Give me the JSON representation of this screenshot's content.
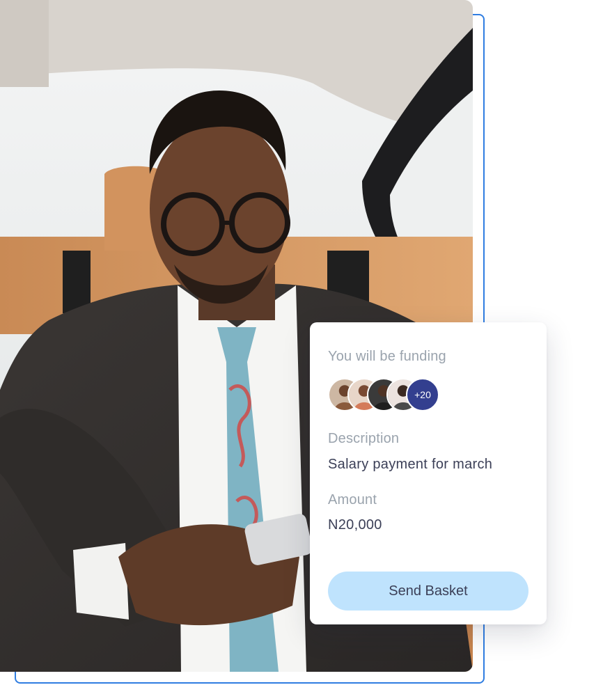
{
  "card": {
    "funding_label": "You will be funding",
    "avatars": [
      {
        "name": "avatar-1",
        "color": "#8a5a3c"
      },
      {
        "name": "avatar-2",
        "color": "#b06a4a"
      },
      {
        "name": "avatar-3",
        "color": "#2c2c2c"
      },
      {
        "name": "avatar-4",
        "color": "#d9c7c0"
      }
    ],
    "more_count": "+20",
    "description_label": "Description",
    "description_value": "Salary payment for march",
    "amount_label": "Amount",
    "amount_value": "N20,000",
    "send_button_label": "Send Basket"
  },
  "colors": {
    "accent_outline": "#2f7de1",
    "button_bg": "#bfe3fd",
    "more_badge": "#333f8f"
  }
}
